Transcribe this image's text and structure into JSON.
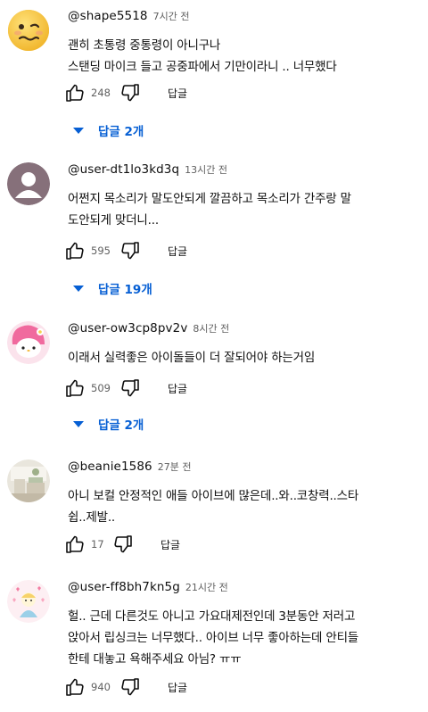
{
  "ui": {
    "reply_label": "답글"
  },
  "comments": [
    {
      "handle": "@shape5518",
      "time": "7시간 전",
      "lines": [
        "괜히 초통령 중통령이 아니구나",
        "스탠딩 마이크 들고 공중파에서 기만이라니 .. 너무했다"
      ],
      "likes": "248",
      "replies_label": "답글 2개",
      "avatar": "woozy-face-emoji"
    },
    {
      "handle": "@user-dt1lo3kd3q",
      "time": "13시간 전",
      "lines": [
        "어쩐지 목소리가 말도안되게 깔끔하고 목소리가 간주랑 말",
        "도안되게 맞더니..."
      ],
      "likes": "595",
      "replies_label": "답글 19개",
      "avatar": "default-person"
    },
    {
      "handle": "@user-ow3cp8pv2v",
      "time": "8시간 전",
      "lines": [
        "이래서 실력좋은 아이돌들이 더 잘되어야 하는거임"
      ],
      "likes": "509",
      "replies_label": "답글 2개",
      "avatar": "my-melody-character"
    },
    {
      "handle": "@beanie1586",
      "time": "27분 전",
      "lines": [
        "아니 보컬 안정적인 애들 아이브에 많은데..와..코창력..스타",
        "쉽..제발.."
      ],
      "likes": "17",
      "replies_label": "",
      "avatar": "room-photo"
    },
    {
      "handle": "@user-ff8bh7kn5g",
      "time": "21시간 전",
      "lines": [
        "헐.. 근데 다른것도 아니고 가요대제전인데 3분동안 저러고",
        "앉아서 립싱크는 너무했다.. 아이브 너무 좋아하는데 안티들",
        "한테 대놓고 욕해주세요 아님? ㅠㅠ"
      ],
      "likes": "940",
      "replies_label": "",
      "avatar": "pastel-hearts-character"
    }
  ]
}
